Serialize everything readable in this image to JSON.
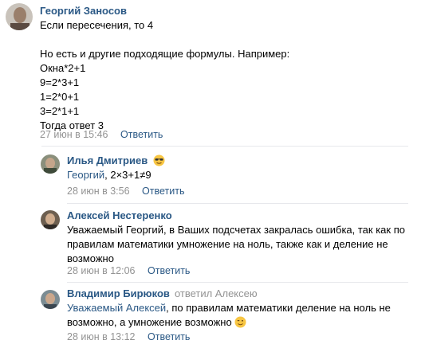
{
  "comments": [
    {
      "author": "Георгий Заносов",
      "lines": [
        "Если пересечения, то 4",
        "",
        "Но есть и другие подходящие формулы. Например:",
        "Окна*2+1",
        "9=2*3+1",
        "1=2*0+1",
        "3=2*1+1",
        "Тогда ответ 3"
      ],
      "date": "27 июн в 15:46",
      "reply_label": "Ответить"
    },
    {
      "author": "Илья Дмитриев",
      "emoji": "sunglasses-emoji",
      "mention": "Георгий",
      "text": ", 2×3+1≠9",
      "date": "28 июн в 3:56",
      "reply_label": "Ответить"
    },
    {
      "author": "Алексей Нестеренко",
      "lines": [
        "Уважаемый Георгий, в Ваших подсчетах закралась ошибка, так как по",
        "правилам математики умножение на ноль, также как и деление не",
        "возможно"
      ],
      "date": "28 июн в 12:06",
      "reply_label": "Ответить"
    },
    {
      "author": "Владимир Бирюков",
      "reply_to": "ответил Алексею",
      "mention": "Уважаемый Алексей",
      "line1_rest": ", по правилам математики деление на ноль не",
      "line2": "возможно, а умножение возможно",
      "emoji": "wink-emoji",
      "date": "28 июн в 13:12",
      "reply_label": "Ответить"
    }
  ],
  "colors": {
    "link": "#2a5885",
    "meta": "#939393",
    "divider": "#e7e8ec"
  }
}
